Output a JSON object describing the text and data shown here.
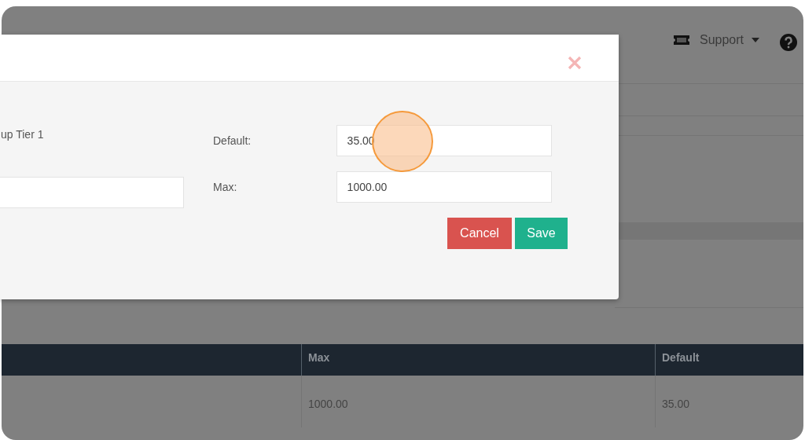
{
  "navbar": {
    "support_menu": {
      "label": "Support"
    }
  },
  "table": {
    "columns": [
      "Max",
      "Default"
    ],
    "rows": [
      {
        "max": "1000.00",
        "default": "35.00"
      }
    ]
  },
  "modal": {
    "name_text": "up Tier 1",
    "fields": [
      {
        "label": "Default:",
        "value": "35.00"
      },
      {
        "label": "Max:",
        "value": "1000.00"
      }
    ],
    "buttons": [
      {
        "kind": "cancel",
        "label": "Cancel"
      },
      {
        "kind": "save",
        "label": "Save"
      }
    ]
  }
}
